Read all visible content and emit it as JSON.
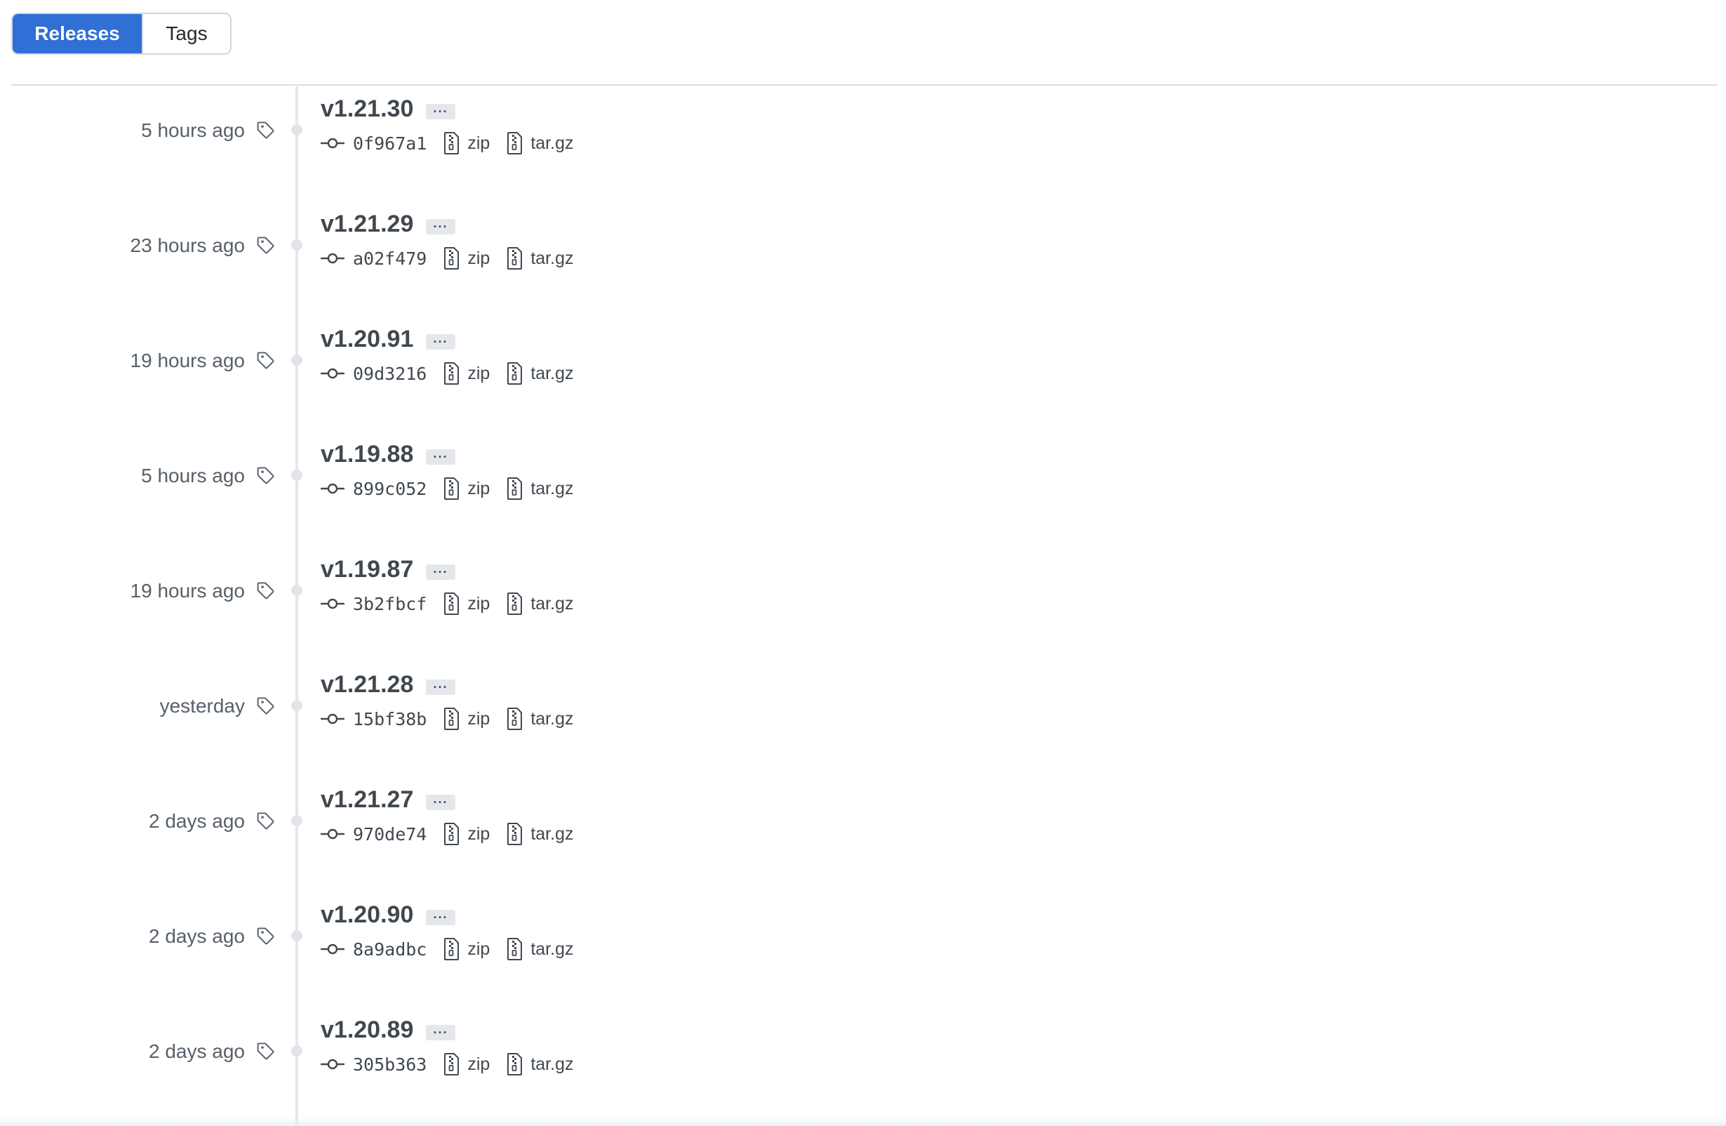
{
  "tabs": {
    "releases": "Releases",
    "tags": "Tags"
  },
  "colors": {
    "accent": "#2f6fd6",
    "timeline": "#e4e8ec",
    "text_muted": "#57606a",
    "text_dark": "#404850"
  },
  "icons": {
    "tag": "tag-icon",
    "commit": "git-commit-icon",
    "archive": "file-zip-icon"
  },
  "releases": [
    {
      "date": "5 hours ago",
      "version": "v1.21.30",
      "more": "···",
      "sha": "0f967a1",
      "zip": "zip",
      "targz": "tar.gz"
    },
    {
      "date": "23 hours ago",
      "version": "v1.21.29",
      "more": "···",
      "sha": "a02f479",
      "zip": "zip",
      "targz": "tar.gz"
    },
    {
      "date": "19 hours ago",
      "version": "v1.20.91",
      "more": "···",
      "sha": "09d3216",
      "zip": "zip",
      "targz": "tar.gz"
    },
    {
      "date": "5 hours ago",
      "version": "v1.19.88",
      "more": "···",
      "sha": "899c052",
      "zip": "zip",
      "targz": "tar.gz"
    },
    {
      "date": "19 hours ago",
      "version": "v1.19.87",
      "more": "···",
      "sha": "3b2fbcf",
      "zip": "zip",
      "targz": "tar.gz"
    },
    {
      "date": "yesterday",
      "version": "v1.21.28",
      "more": "···",
      "sha": "15bf38b",
      "zip": "zip",
      "targz": "tar.gz"
    },
    {
      "date": "2 days ago",
      "version": "v1.21.27",
      "more": "···",
      "sha": "970de74",
      "zip": "zip",
      "targz": "tar.gz"
    },
    {
      "date": "2 days ago",
      "version": "v1.20.90",
      "more": "···",
      "sha": "8a9adbc",
      "zip": "zip",
      "targz": "tar.gz"
    },
    {
      "date": "2 days ago",
      "version": "v1.20.89",
      "more": "···",
      "sha": "305b363",
      "zip": "zip",
      "targz": "tar.gz"
    }
  ]
}
